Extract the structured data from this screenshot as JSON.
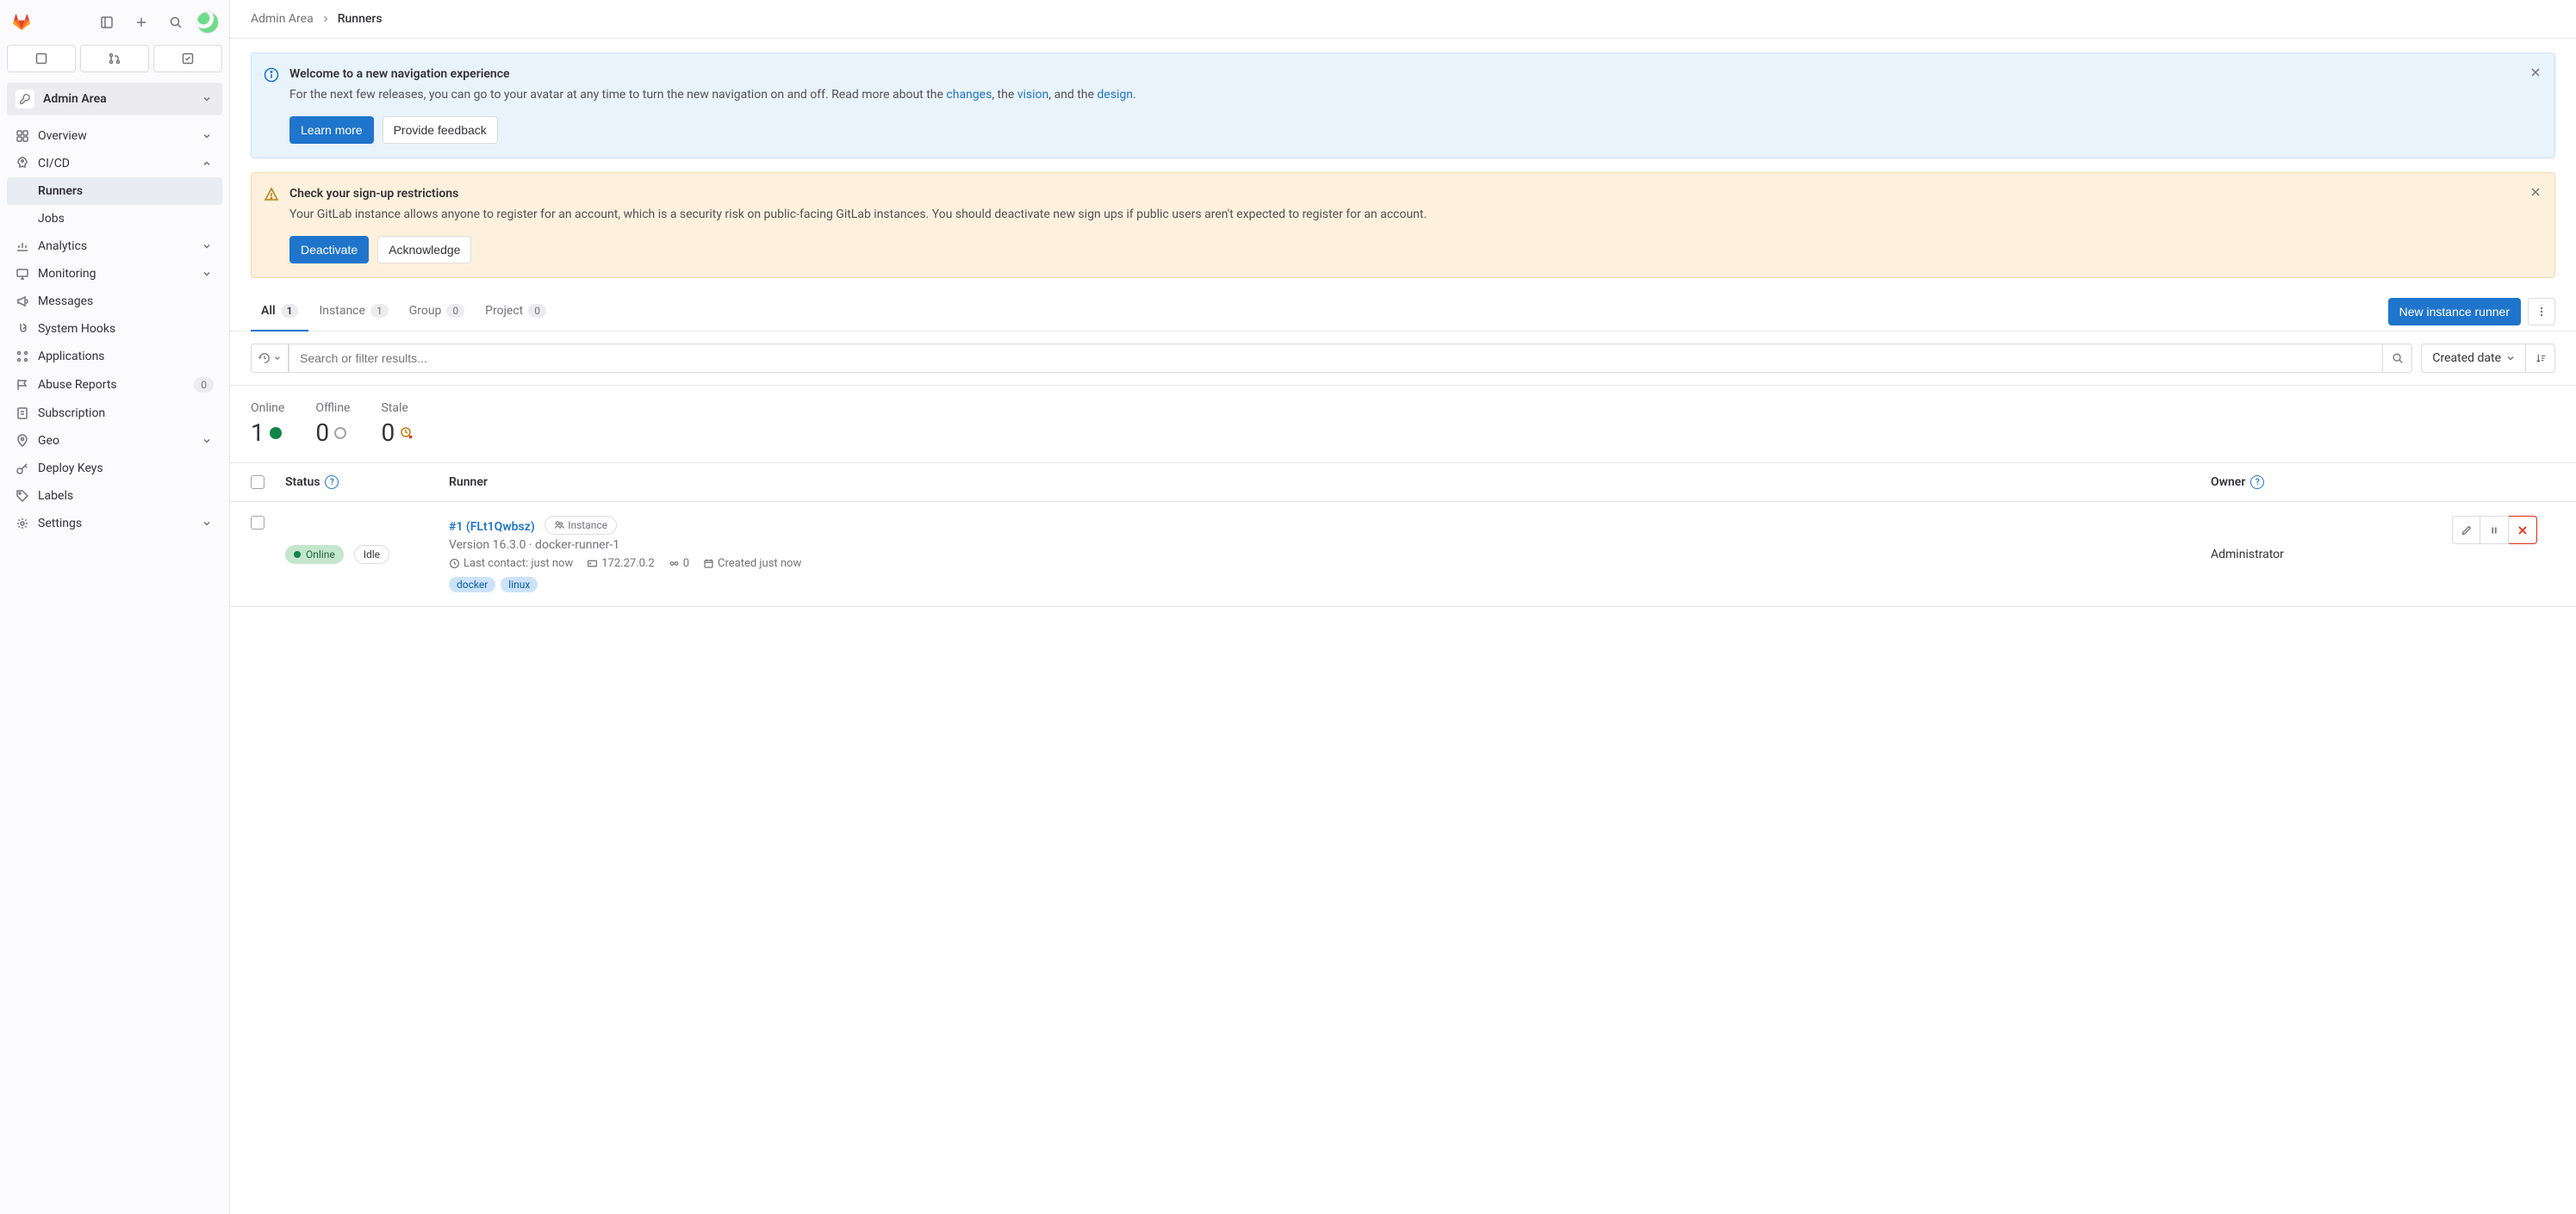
{
  "header": {
    "context_label": "Admin Area"
  },
  "breadcrumb": {
    "root": "Admin Area",
    "current": "Runners"
  },
  "sidebar": {
    "items": [
      {
        "label": "Overview",
        "icon": "grid-icon",
        "expandable": true
      },
      {
        "label": "CI/CD",
        "icon": "rocket-icon",
        "expandable": true,
        "expanded": true,
        "children": [
          {
            "label": "Runners",
            "active": true
          },
          {
            "label": "Jobs"
          }
        ]
      },
      {
        "label": "Analytics",
        "icon": "chart-icon",
        "expandable": true
      },
      {
        "label": "Monitoring",
        "icon": "monitor-icon",
        "expandable": true
      },
      {
        "label": "Messages",
        "icon": "megaphone-icon"
      },
      {
        "label": "System Hooks",
        "icon": "hook-icon"
      },
      {
        "label": "Applications",
        "icon": "apps-icon"
      },
      {
        "label": "Abuse Reports",
        "icon": "flag-icon",
        "badge": "0"
      },
      {
        "label": "Subscription",
        "icon": "license-icon"
      },
      {
        "label": "Geo",
        "icon": "location-icon",
        "expandable": true
      },
      {
        "label": "Deploy Keys",
        "icon": "key-icon"
      },
      {
        "label": "Labels",
        "icon": "label-icon"
      },
      {
        "label": "Settings",
        "icon": "gear-icon",
        "expandable": true
      }
    ]
  },
  "alerts": {
    "nav": {
      "title": "Welcome to a new navigation experience",
      "body_pre": "For the next few releases, you can go to your avatar at any time to turn the new navigation on and off. Read more about the ",
      "link1": "changes",
      "body_mid1": ", the ",
      "link2": "vision",
      "body_mid2": ", and the ",
      "link3": "design",
      "body_post": ".",
      "learn_more": "Learn more",
      "feedback": "Provide feedback"
    },
    "signup": {
      "title": "Check your sign-up restrictions",
      "body": "Your GitLab instance allows anyone to register for an account, which is a security risk on public-facing GitLab instances. You should deactivate new sign ups if public users aren't expected to register for an account.",
      "deactivate": "Deactivate",
      "acknowledge": "Acknowledge"
    }
  },
  "tabs": [
    {
      "label": "All",
      "count": "1",
      "active": true
    },
    {
      "label": "Instance",
      "count": "1"
    },
    {
      "label": "Group",
      "count": "0"
    },
    {
      "label": "Project",
      "count": "0"
    }
  ],
  "actions": {
    "new_runner": "New instance runner"
  },
  "filter": {
    "placeholder": "Search or filter results...",
    "sort": "Created date"
  },
  "stats": {
    "online": {
      "label": "Online",
      "value": "1"
    },
    "offline": {
      "label": "Offline",
      "value": "0"
    },
    "stale": {
      "label": "Stale",
      "value": "0"
    }
  },
  "table": {
    "headers": {
      "status": "Status",
      "runner": "Runner",
      "owner": "Owner"
    },
    "rows": [
      {
        "status": "Online",
        "idle": "Idle",
        "id": "#1 (FLt1Qwbsz)",
        "type": "Instance",
        "version_line": "Version 16.3.0 · docker-runner-1",
        "last_contact": "Last contact: just now",
        "ip": "172.27.0.2",
        "jobs": "0",
        "created": "Created just now",
        "tags": [
          "docker",
          "linux"
        ],
        "owner": "Administrator"
      }
    ]
  }
}
